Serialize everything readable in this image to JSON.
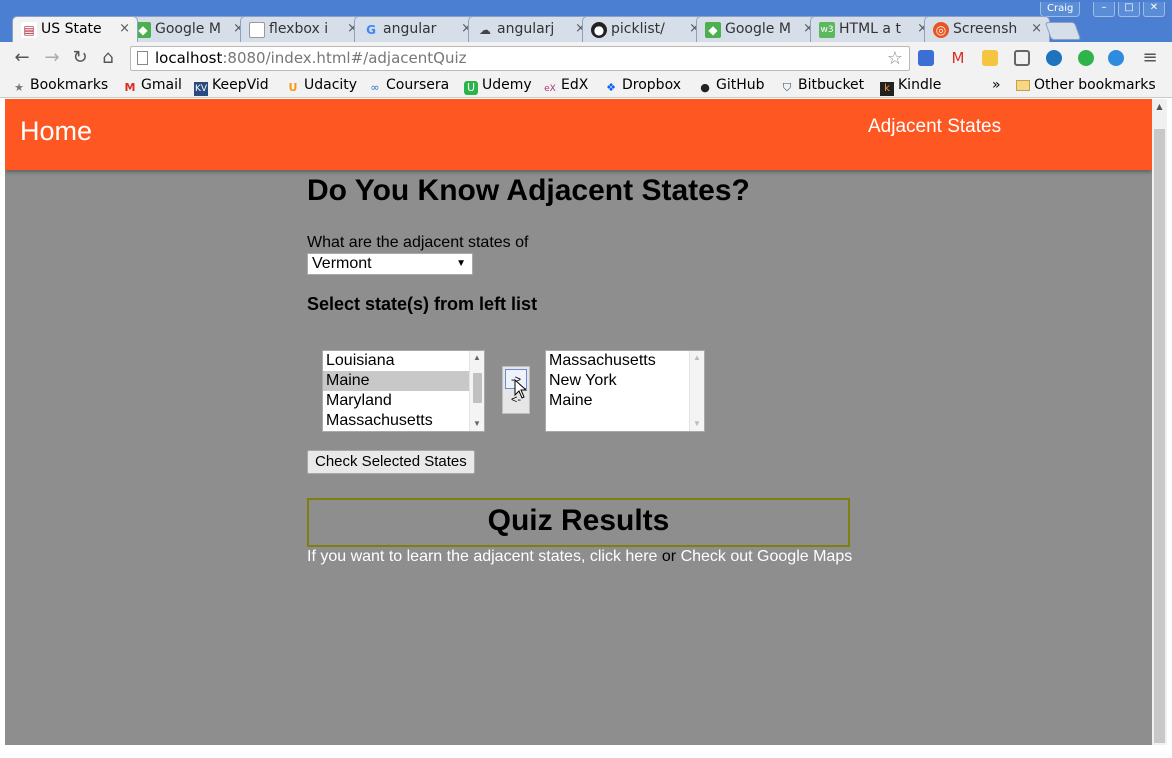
{
  "browser": {
    "user_name": "Craig",
    "tabs": [
      {
        "title": "US State",
        "icon": "us-flag-icon",
        "active": true
      },
      {
        "title": "Google M",
        "icon": "google-maps-icon",
        "active": false
      },
      {
        "title": "flexbox i",
        "icon": "page-icon",
        "active": false
      },
      {
        "title": "angular",
        "icon": "google-g-icon",
        "active": false
      },
      {
        "title": "angularj",
        "icon": "cloud-icon",
        "active": false
      },
      {
        "title": "picklist/",
        "icon": "github-icon",
        "active": false
      },
      {
        "title": "Google M",
        "icon": "google-maps-icon",
        "active": false
      },
      {
        "title": "HTML a t",
        "icon": "w3schools-icon",
        "active": false
      },
      {
        "title": "Screensh",
        "icon": "ubuntu-icon",
        "active": false
      }
    ],
    "url_host": "localhost",
    "url_rest": ":8080/index.html#/adjacentQuiz",
    "bookmarks": [
      {
        "label": "Bookmarks",
        "icon": "star-icon"
      },
      {
        "label": "Gmail",
        "icon": "gmail-icon"
      },
      {
        "label": "KeepVid",
        "icon": "keepvid-icon"
      },
      {
        "label": "Udacity",
        "icon": "udacity-icon"
      },
      {
        "label": "Coursera",
        "icon": "coursera-icon"
      },
      {
        "label": "Udemy",
        "icon": "udemy-icon"
      },
      {
        "label": "EdX",
        "icon": "edx-icon"
      },
      {
        "label": "Dropbox",
        "icon": "dropbox-icon"
      },
      {
        "label": "GitHub",
        "icon": "github-icon"
      },
      {
        "label": "Bitbucket",
        "icon": "bitbucket-icon"
      },
      {
        "label": "Kindle",
        "icon": "kindle-icon"
      }
    ],
    "overflow_chevron": "»",
    "other_bookmarks": "Other bookmarks"
  },
  "app": {
    "header_color": "#ff5722",
    "background_color": "#8e8e8e",
    "home_label": "Home",
    "nav_label": "Adjacent States"
  },
  "quiz": {
    "title": "Do You Know Adjacent States?",
    "prompt": "What are the adjacent states of",
    "selected_state": "Vermont",
    "instruction": "Select state(s) from left list",
    "left_list": [
      "Louisiana",
      "Maine",
      "Maryland",
      "Massachusetts"
    ],
    "left_selected": "Maine",
    "right_list": [
      "Massachusetts",
      "New York",
      "Maine"
    ],
    "move_right_label": "->",
    "move_left_label": "<-",
    "check_button": "Check Selected States"
  },
  "results": {
    "title": "Quiz Results",
    "help_text_1": "If you want to learn the adjacent states, click here",
    "help_sep": "or",
    "help_text_2": "Check out Google Maps"
  }
}
